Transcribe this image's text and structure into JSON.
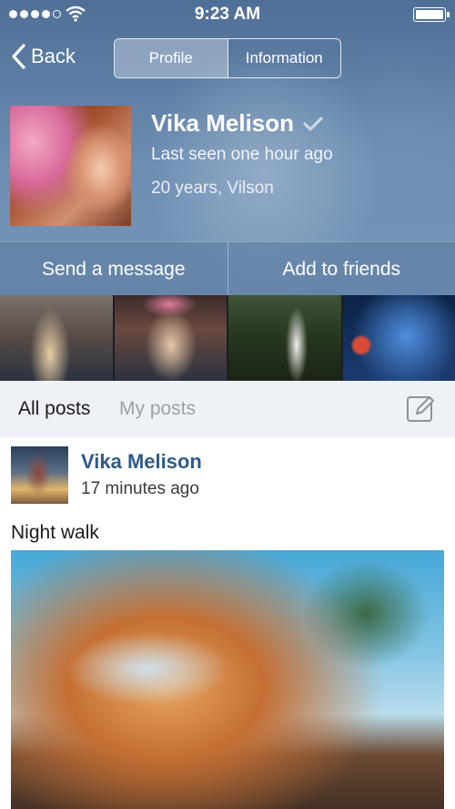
{
  "status_bar": {
    "time": "9:23 AM"
  },
  "nav": {
    "back_label": "Back",
    "tabs": [
      {
        "label": "Profile"
      },
      {
        "label": "Information"
      }
    ]
  },
  "profile": {
    "name": "Vika Melison",
    "last_seen": "Last seen one hour ago",
    "age_location": "20 years, Vilson"
  },
  "actions": {
    "send_message": "Send a message",
    "add_friends": "Add to friends"
  },
  "feed_tabs": {
    "all": "All posts",
    "my": "My posts"
  },
  "post": {
    "author": "Vika Melison",
    "time": "17 minutes ago",
    "text": "Night walk"
  },
  "colors": {
    "header": "#5d7ea4",
    "author_link": "#2f5a87",
    "inactive_tab": "#9aa1aa"
  },
  "icons": [
    "signal-dots-icon",
    "wifi-icon",
    "battery-icon",
    "back-chevron-icon",
    "verified-check-icon",
    "compose-icon"
  ]
}
